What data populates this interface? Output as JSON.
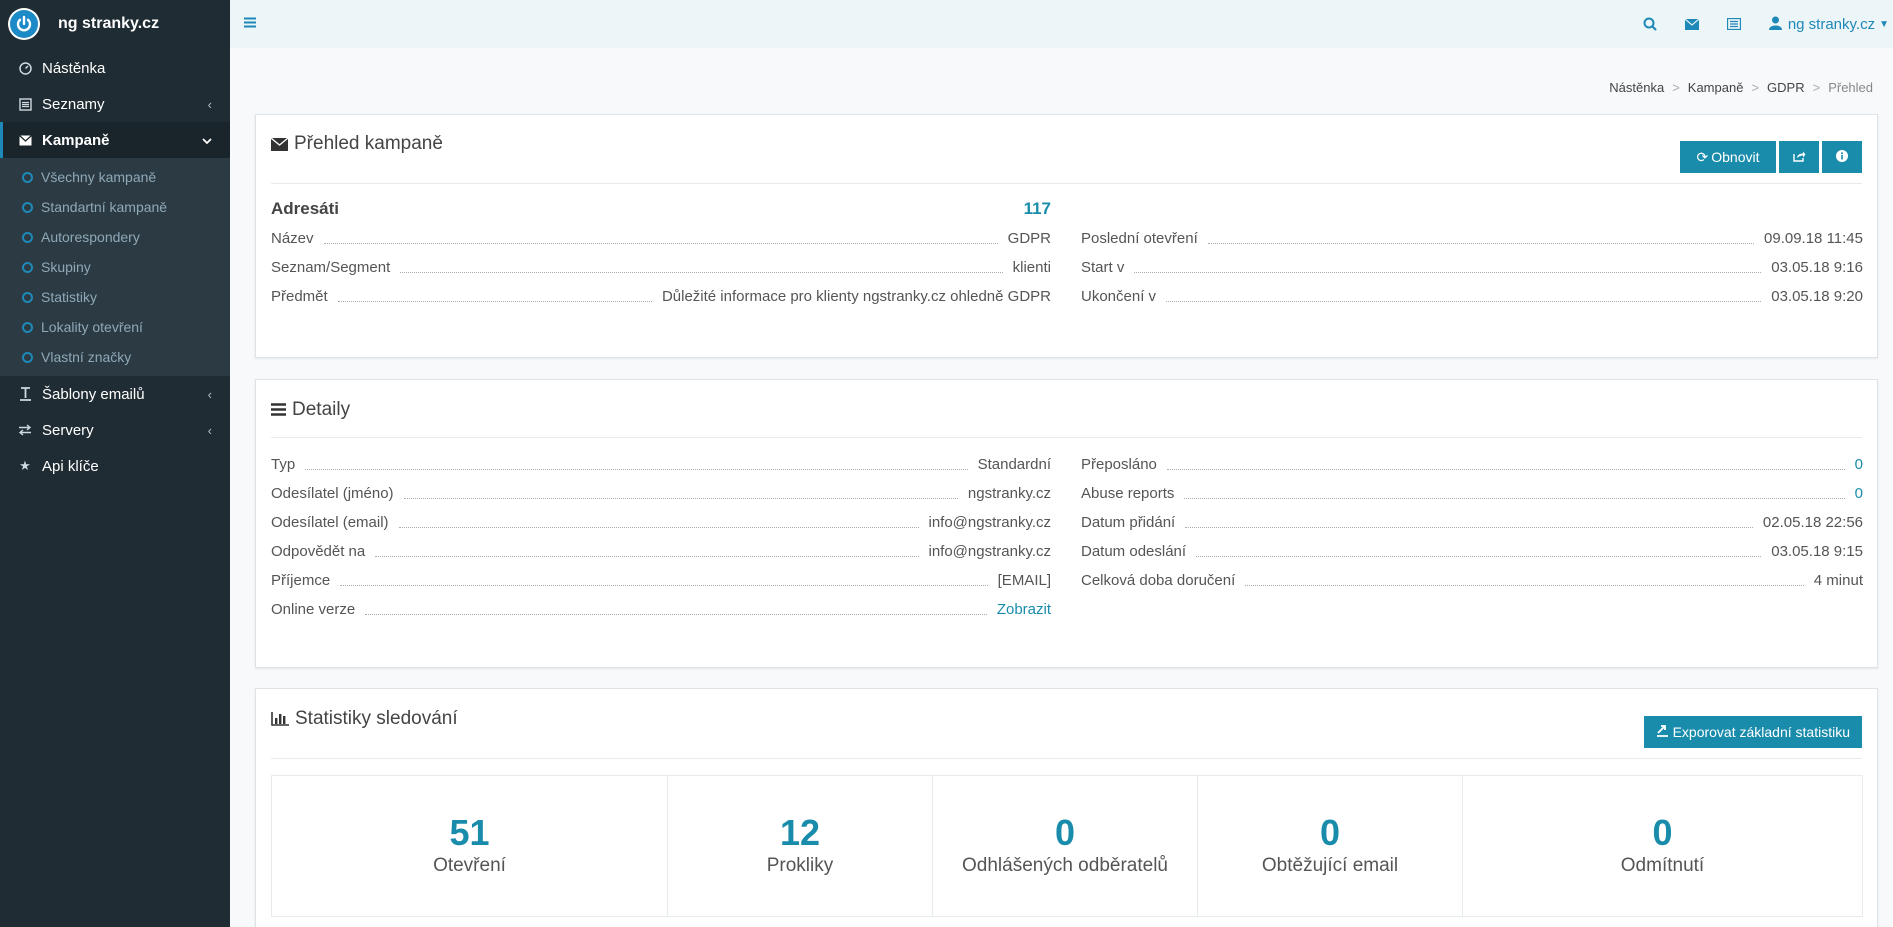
{
  "brand": {
    "name": "ng stranky.cz"
  },
  "sidebar": {
    "items": [
      {
        "label": "Nástěnka",
        "icon": "dashboard-icon"
      },
      {
        "label": "Seznamy",
        "icon": "list-icon"
      },
      {
        "label": "Kampaně",
        "icon": "envelope-icon"
      },
      {
        "label": "Šablony emailů",
        "icon": "text-icon"
      },
      {
        "label": "Servery",
        "icon": "exchange-icon"
      },
      {
        "label": "Api klíče",
        "icon": "star-icon"
      }
    ],
    "sub_items": [
      "Všechny kampaně",
      "Standartní kampaně",
      "Autorespondery",
      "Skupiny",
      "Statistiky",
      "Lokality otevření",
      "Vlastní značky"
    ]
  },
  "topbar": {
    "user": "ng stranky.cz"
  },
  "breadcrumb": [
    "Nástěnka",
    "Kampaně",
    "GDPR",
    "Přehled"
  ],
  "overview": {
    "title": "Přehled kampaně",
    "refresh_label": "Obnovit",
    "recipients_label": "Adresáti",
    "recipients_value": "117",
    "left": [
      {
        "k": "Název",
        "v": "GDPR"
      },
      {
        "k": "Seznam/Segment",
        "v": "klienti"
      },
      {
        "k": "Předmět",
        "v": "Důležité informace pro klienty ngstranky.cz ohledně GDPR"
      }
    ],
    "right": [
      {
        "k": "Poslední otevření",
        "v": "09.09.18 11:45"
      },
      {
        "k": "Start v",
        "v": "03.05.18 9:16"
      },
      {
        "k": "Ukončení v",
        "v": "03.05.18 9:20"
      }
    ]
  },
  "details": {
    "title": "Detaily",
    "left": [
      {
        "k": "Typ",
        "v": "Standardní"
      },
      {
        "k": "Odesílatel (jméno)",
        "v": "ngstranky.cz"
      },
      {
        "k": "Odesílatel (email)",
        "v": "info@ngstranky.cz"
      },
      {
        "k": "Odpovědět na",
        "v": "info@ngstranky.cz"
      },
      {
        "k": "Příjemce",
        "v": "[EMAIL]"
      },
      {
        "k": "Online verze",
        "v": "Zobrazit"
      }
    ],
    "right": [
      {
        "k": "Přeposláno",
        "v": "0"
      },
      {
        "k": "Abuse reports",
        "v": "0"
      },
      {
        "k": "Datum přidání",
        "v": "02.05.18 22:56"
      },
      {
        "k": "Datum odeslání",
        "v": "03.05.18 9:15"
      },
      {
        "k": "Celková doba doručení",
        "v": "4 minut"
      }
    ]
  },
  "stats": {
    "title": "Statistiky sledování",
    "export_label": "Exporovat základní statistiku",
    "boxes": [
      {
        "num": "51",
        "label": "Otevření"
      },
      {
        "num": "12",
        "label": "Prokliky"
      },
      {
        "num": "0",
        "label": "Odhlášených odběratelů"
      },
      {
        "num": "0",
        "label": "Obtěžující email"
      },
      {
        "num": "0",
        "label": "Odmítnutí"
      }
    ]
  },
  "colors": {
    "accent": "#1a8cab",
    "sidebar": "#1f2c33",
    "submenu": "#2c3b43"
  }
}
